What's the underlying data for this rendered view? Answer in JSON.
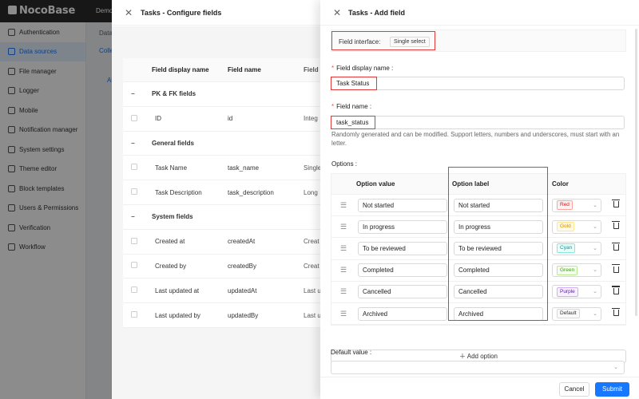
{
  "app": {
    "logo": "NocoBase",
    "topbar_tab": "Demo",
    "sidebar": [
      {
        "label": "Authentication",
        "icon": "key-icon"
      },
      {
        "label": "Data sources",
        "icon": "database-icon",
        "active": true
      },
      {
        "label": "File manager",
        "icon": "file-icon"
      },
      {
        "label": "Logger",
        "icon": "logger-icon"
      },
      {
        "label": "Mobile",
        "icon": "mobile-icon"
      },
      {
        "label": "Notification manager",
        "icon": "bell-icon"
      },
      {
        "label": "System settings",
        "icon": "gear-icon"
      },
      {
        "label": "Theme editor",
        "icon": "palette-icon"
      },
      {
        "label": "Block templates",
        "icon": "layout-icon"
      },
      {
        "label": "Users & Permissions",
        "icon": "users-icon"
      },
      {
        "label": "Verification",
        "icon": "shield-icon"
      },
      {
        "label": "Workflow",
        "icon": "workflow-icon"
      }
    ],
    "bg_tabs": {
      "t1": "Data",
      "t2": "Colle",
      "t3": "Al"
    }
  },
  "configure": {
    "title": "Tasks - Configure fields",
    "columns": [
      "Field display name",
      "Field name",
      "Field i"
    ],
    "groups": [
      {
        "label": "PK & FK fields",
        "rows": [
          {
            "display": "ID",
            "name": "id",
            "iface": "Integ"
          }
        ]
      },
      {
        "label": "General fields",
        "rows": [
          {
            "display": "Task Name",
            "name": "task_name",
            "iface": "Single"
          },
          {
            "display": "Task Description",
            "name": "task_description",
            "iface": "Long"
          }
        ]
      },
      {
        "label": "System fields",
        "rows": [
          {
            "display": "Created at",
            "name": "createdAt",
            "iface": "Creat"
          },
          {
            "display": "Created by",
            "name": "createdBy",
            "iface": "Creat"
          },
          {
            "display": "Last updated at",
            "name": "updatedAt",
            "iface": "Last u"
          },
          {
            "display": "Last updated by",
            "name": "updatedBy",
            "iface": "Last u"
          }
        ]
      }
    ]
  },
  "add_field": {
    "title": "Tasks - Add field",
    "interface_label": "Field interface:",
    "interface_value": "Single select",
    "display_name_label": "Field display name",
    "display_name_value": "Task Status",
    "field_name_label": "Field name",
    "field_name_value": "task_status",
    "field_name_help": "Randomly generated and can be modified. Support letters, numbers and underscores, must start with an letter.",
    "options_label": "Options",
    "options_columns": {
      "value": "Option value",
      "label": "Option label",
      "color": "Color"
    },
    "options": [
      {
        "value": "Not started",
        "label": "Not started",
        "color": "Red",
        "fg": "#cf1322",
        "bg": "#fff1f0",
        "border": "#ffa39e"
      },
      {
        "value": "In progress",
        "label": "In progress",
        "color": "Gold",
        "fg": "#d48806",
        "bg": "#fffbe6",
        "border": "#ffe58f"
      },
      {
        "value": "To be reviewed",
        "label": "To be reviewed",
        "color": "Cyan",
        "fg": "#08979c",
        "bg": "#e6fffb",
        "border": "#87e8de"
      },
      {
        "value": "Completed",
        "label": "Completed",
        "color": "Green",
        "fg": "#389e0d",
        "bg": "#f6ffed",
        "border": "#b7eb8f"
      },
      {
        "value": "Cancelled",
        "label": "Cancelled",
        "color": "Purple",
        "fg": "#531dab",
        "bg": "#f9f0ff",
        "border": "#d3adf7"
      },
      {
        "value": "Archived",
        "label": "Archived",
        "color": "Default",
        "fg": "#333333",
        "bg": "#fafafa",
        "border": "#d9d9d9"
      }
    ],
    "add_option_label": "Add option",
    "default_value_label": "Default value",
    "cancel_label": "Cancel",
    "submit_label": "Submit",
    "accent_color": "#1677ff",
    "highlight_color": "#e03a3a"
  }
}
